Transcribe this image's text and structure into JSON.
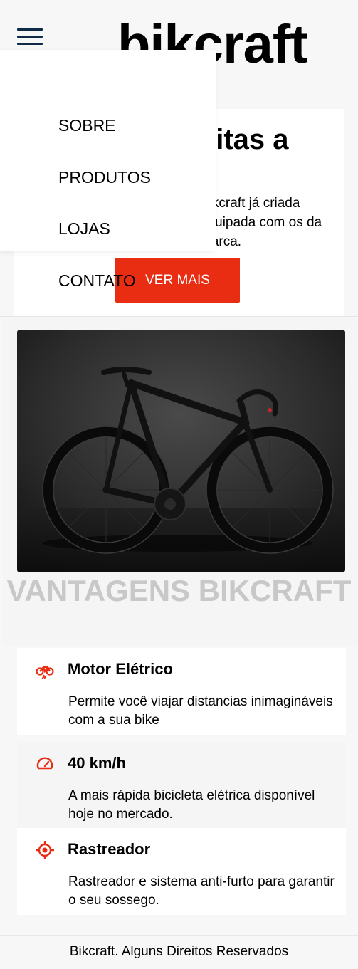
{
  "header": {
    "logo": "bikcraft",
    "menu_icon": "hamburger-menu-icon"
  },
  "nav": {
    "items": [
      {
        "label": "SOBRE"
      },
      {
        "label": "PRODUTOS"
      },
      {
        "label": "LOJAS"
      },
      {
        "label": "CONTATO"
      }
    ]
  },
  "intro": {
    "title_visible": "eitas a",
    "text_visible": "Bikcraft já criada equipada com os da marca.",
    "cta_label": "VER MAIS"
  },
  "bike_image": {
    "icon": "bicycle-photo"
  },
  "advantages": {
    "heading": "VANTAGENS BIKCRAFT",
    "items": [
      {
        "icon": "electric-bike-icon",
        "title": "Motor Elétrico",
        "description": "Permite você viajar distancias inimagináveis com a sua bike"
      },
      {
        "icon": "speedometer-icon",
        "title": "40 km/h",
        "description": "A mais rápida bicicleta elétrica disponível hoje no mercado."
      },
      {
        "icon": "target-icon",
        "title": "Rastreador",
        "description": "Rastreador e sistema anti-furto para garantir o seu sossego."
      }
    ]
  },
  "footer": {
    "text": "Bikcraft. Alguns Direitos Reservados"
  },
  "colors": {
    "accent": "#e92d13",
    "menu_icon": "#0e2a47",
    "heading_muted": "#c8c8c8"
  }
}
